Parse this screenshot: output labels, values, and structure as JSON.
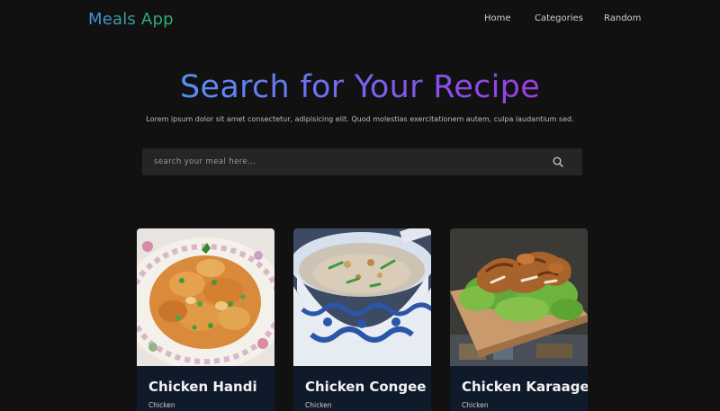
{
  "header": {
    "logo": "Meals App",
    "nav": [
      {
        "label": "Home"
      },
      {
        "label": "Categories"
      },
      {
        "label": "Random"
      }
    ]
  },
  "hero": {
    "title": "Search for Your Recipe",
    "subtitle": "Lorem ipsum dolor sit amet consectetur, adipisicing elit. Quod molestias exercitationem autem, culpa laudantium sed."
  },
  "search": {
    "placeholder": "search your meal here...",
    "value": ""
  },
  "meals": [
    {
      "name": "Chicken Handi",
      "category": "Chicken"
    },
    {
      "name": "Chicken Congee",
      "category": "Chicken"
    },
    {
      "name": "Chicken Karaage",
      "category": "Chicken"
    }
  ],
  "colors": {
    "background": "#111112",
    "card_footer": "#0f1a2b",
    "search_bg": "#252526"
  }
}
